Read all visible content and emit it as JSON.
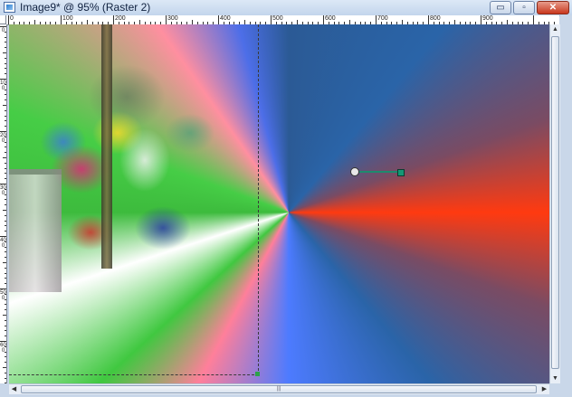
{
  "window": {
    "title": "Image9* @  95% (Raster 2)",
    "icon": "image-document-icon",
    "buttons": {
      "minimize": "▭",
      "maximize": "▫",
      "close": "✕"
    }
  },
  "ruler": {
    "top_labels": [
      "0",
      "100",
      "200",
      "300",
      "400",
      "500",
      "600",
      "700",
      "800",
      "900"
    ],
    "left_labels": [
      "0",
      "100",
      "200",
      "300",
      "400",
      "500",
      "600"
    ]
  },
  "scrollbars": {
    "up_arrow": "▲",
    "down_arrow": "▼",
    "left_arrow": "◀",
    "right_arrow": "▶",
    "grip": "|||"
  },
  "colors": {
    "gradient_center": "#ff3a10",
    "gradient_blue": "#2b5a95",
    "gradient_green": "#40c840",
    "gradient_pink": "#ff8fa0",
    "selection_handle": "#2ca24a",
    "gradient_tool_line": "#1e8a6d"
  }
}
